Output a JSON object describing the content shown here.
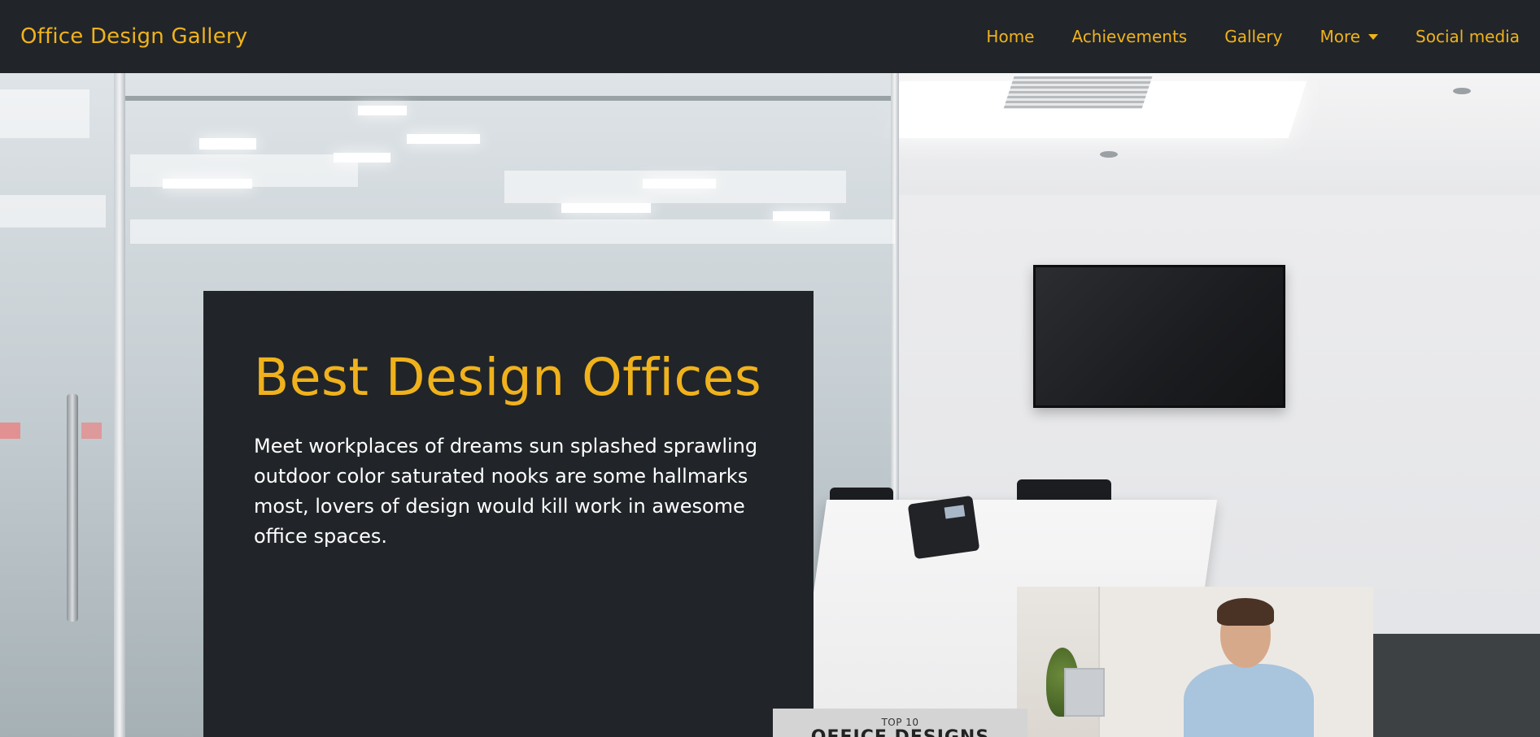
{
  "navbar": {
    "brand": "Office Design Gallery",
    "links": [
      {
        "label": "Home"
      },
      {
        "label": "Achievements"
      },
      {
        "label": "Gallery"
      },
      {
        "label": "More"
      },
      {
        "label": "Social media"
      }
    ]
  },
  "hero": {
    "title": "Best Design Offices",
    "description": "Meet workplaces of dreams sun splashed sprawling outdoor color saturated nooks are some hallmarks most, lovers of design would kill work in awesome office spaces."
  },
  "promo": {
    "small_text": "TOP 10",
    "big_text": "OFFICE DESIGNS"
  },
  "colors": {
    "navbar_bg": "#212529",
    "accent": "#f0b21c",
    "card_bg": "#212529",
    "text_light": "#ffffff"
  },
  "icons": {
    "more_dropdown": "caret-down-icon"
  }
}
